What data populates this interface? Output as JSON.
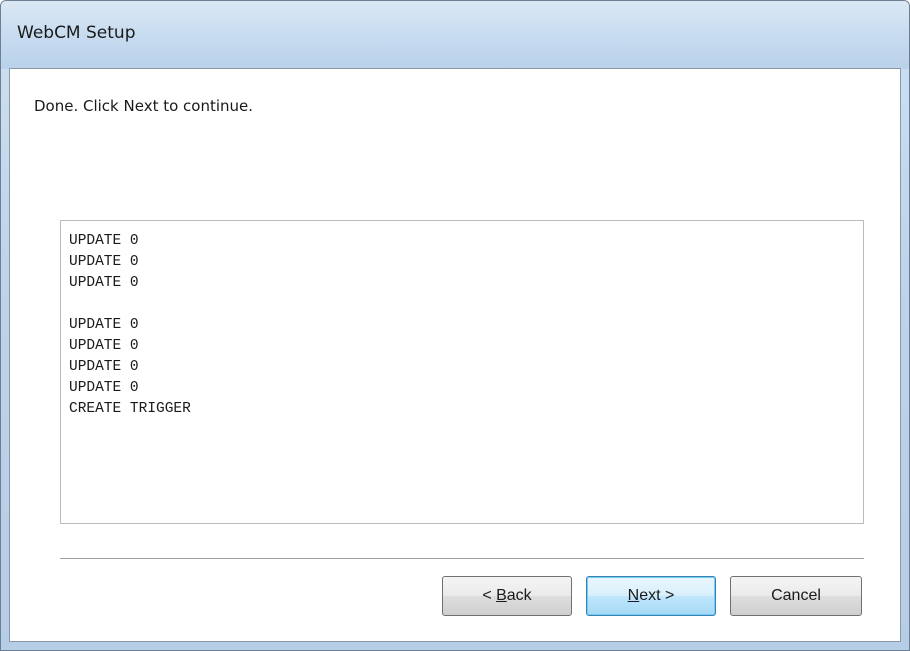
{
  "window": {
    "title": "WebCM Setup"
  },
  "main": {
    "status_text": "Done. Click Next to continue.",
    "log_lines": [
      "UPDATE 0",
      "UPDATE 0",
      "UPDATE 0",
      "",
      "UPDATE 0",
      "UPDATE 0",
      "UPDATE 0",
      "UPDATE 0",
      "CREATE TRIGGER"
    ]
  },
  "buttons": {
    "back": {
      "prefix": "< ",
      "mnemonic": "B",
      "rest": "ack"
    },
    "next": {
      "prefix": "",
      "mnemonic": "N",
      "rest": "ext >"
    },
    "cancel": {
      "label": "Cancel"
    }
  },
  "colors": {
    "titlebar": "#c6dbef",
    "default_button_border": "#3c7fb1"
  }
}
